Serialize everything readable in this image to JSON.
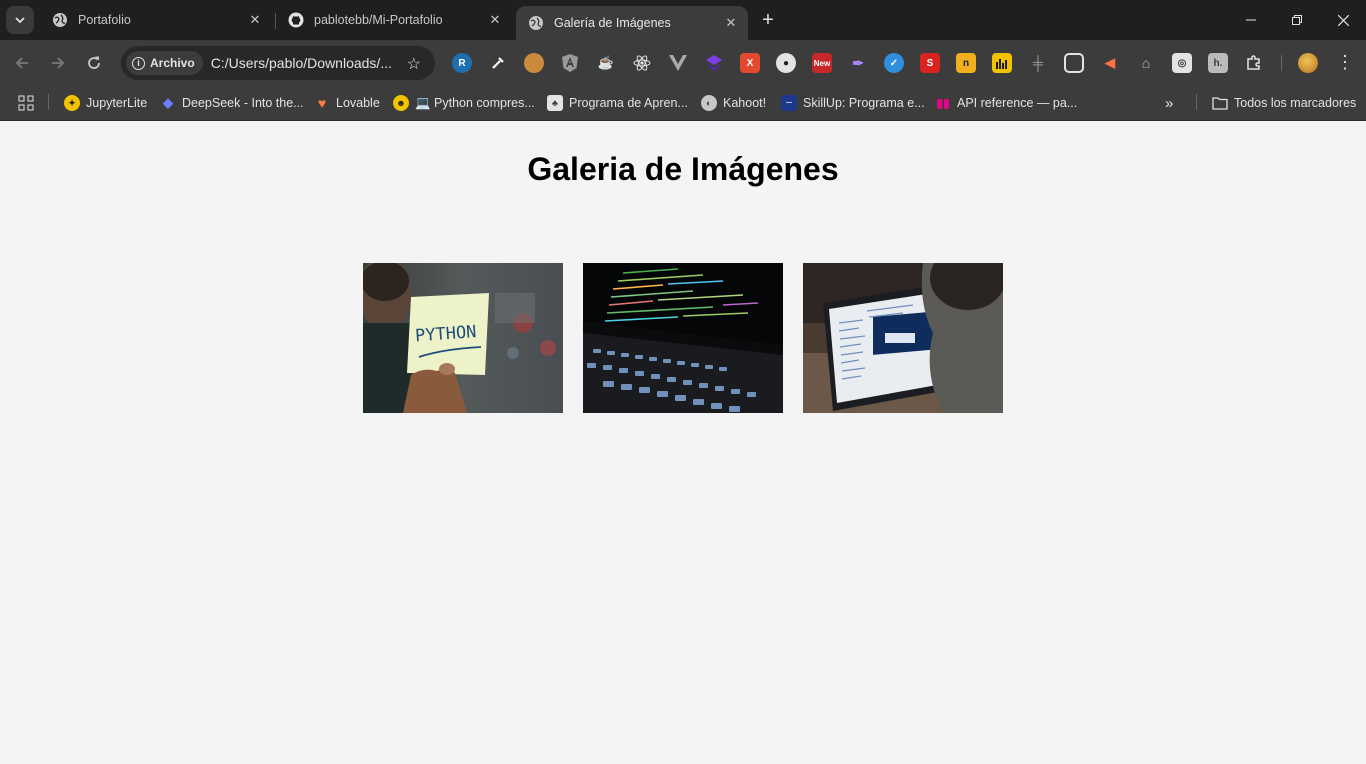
{
  "tabs": [
    {
      "title": "Portafolio",
      "favicon": "globe-icon",
      "active": false
    },
    {
      "title": "pablotebb/Mi-Portafolio",
      "favicon": "github-icon",
      "active": false
    },
    {
      "title": "Galería de Imágenes",
      "favicon": "globe-icon",
      "active": true
    }
  ],
  "toolbar": {
    "chip_label": "Archivo",
    "url": "C:/Users/pablo/Downloads/..."
  },
  "bookmarks": {
    "items": [
      {
        "label": "JupyterLite",
        "icon": "jupyterlite-icon"
      },
      {
        "label": "DeepSeek - Into the...",
        "icon": "deepseek-icon"
      },
      {
        "label": "Lovable",
        "icon": "lovable-heart-icon"
      },
      {
        "label": "💻 Python compres...",
        "icon": "emoji-icon"
      },
      {
        "label": "Programa de Apren...",
        "icon": "program-icon"
      },
      {
        "label": "Kahoot!",
        "icon": "globe-icon"
      },
      {
        "label": "SkillUp: Programa e...",
        "icon": "skillup-icon"
      },
      {
        "label": "API reference — pa...",
        "icon": "pandas-icon"
      }
    ],
    "all_bookmarks": "Todos los marcadores"
  },
  "page": {
    "title": "Galeria de Imágenes",
    "images": [
      {
        "name": "python-sticky-note-photo",
        "text": "PYTHON"
      },
      {
        "name": "laptop-code-keyboard-photo"
      },
      {
        "name": "person-laptop-code-photo"
      }
    ]
  },
  "colors": {
    "tab_bg": "#1f1f1f",
    "toolbar_bg": "#3c3c3c",
    "page_bg": "#f4f4f4"
  }
}
